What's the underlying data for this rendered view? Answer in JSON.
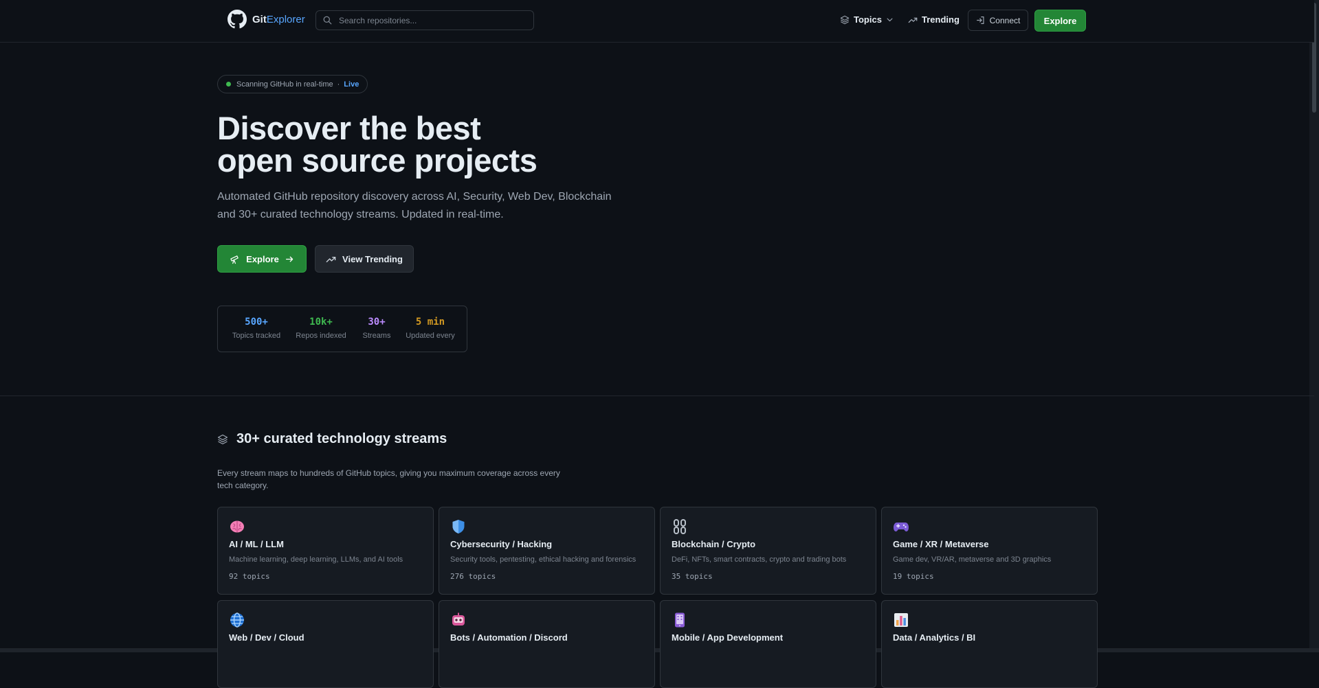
{
  "header": {
    "logo_part1": "Git",
    "logo_part2": "Explorer",
    "search_placeholder": "Search repositories...",
    "nav_topics": "Topics",
    "nav_trending": "Trending",
    "connect": "Connect",
    "explore": "Explore"
  },
  "hero": {
    "badge_text": "Scanning GitHub in real-time",
    "badge_sep": "·",
    "badge_live": "Live",
    "title_line1": "Discover the best",
    "title_line2": "open source projects",
    "subtitle": "Automated GitHub repository discovery across AI, Security, Web Dev, Blockchain and 30+ curated technology streams. Updated in real-time.",
    "explore_button": "Explore",
    "trending_button": "View Trending"
  },
  "stats": [
    {
      "value": "500+",
      "label": "Topics tracked",
      "color": "#58a6ff"
    },
    {
      "value": "10k+",
      "label": "Repos indexed",
      "color": "#3fb950"
    },
    {
      "value": "30+",
      "label": "Streams",
      "color": "#bc8cff"
    },
    {
      "value": "5 min",
      "label": "Updated every",
      "color": "#d29922"
    }
  ],
  "streams": {
    "title": "30+ curated technology streams",
    "description": "Every stream maps to hundreds of GitHub topics, giving you maximum coverage across every tech category.",
    "cards": [
      {
        "name": "AI / ML / LLM",
        "description": "Machine learning, deep learning, LLMs, and AI tools",
        "topics": "92 topics",
        "icon": "brain-icon"
      },
      {
        "name": "Cybersecurity / Hacking",
        "description": "Security tools, pentesting, ethical hacking and forensics",
        "topics": "276 topics",
        "icon": "shield-icon"
      },
      {
        "name": "Blockchain / Crypto",
        "description": "DeFi, NFTs, smart contracts, crypto and trading bots",
        "topics": "35 topics",
        "icon": "chain-icon"
      },
      {
        "name": "Game / XR / Metaverse",
        "description": "Game dev, VR/AR, metaverse and 3D graphics",
        "topics": "19 topics",
        "icon": "gamepad-icon"
      },
      {
        "name": "Web / Dev / Cloud",
        "description": "",
        "topics": "",
        "icon": "globe-icon"
      },
      {
        "name": "Bots / Automation / Discord",
        "description": "",
        "topics": "",
        "icon": "robot-icon"
      },
      {
        "name": "Mobile / App Development",
        "description": "",
        "topics": "",
        "icon": "phone-icon"
      },
      {
        "name": "Data / Analytics / BI",
        "description": "",
        "topics": "",
        "icon": "bar-chart-icon"
      }
    ]
  }
}
